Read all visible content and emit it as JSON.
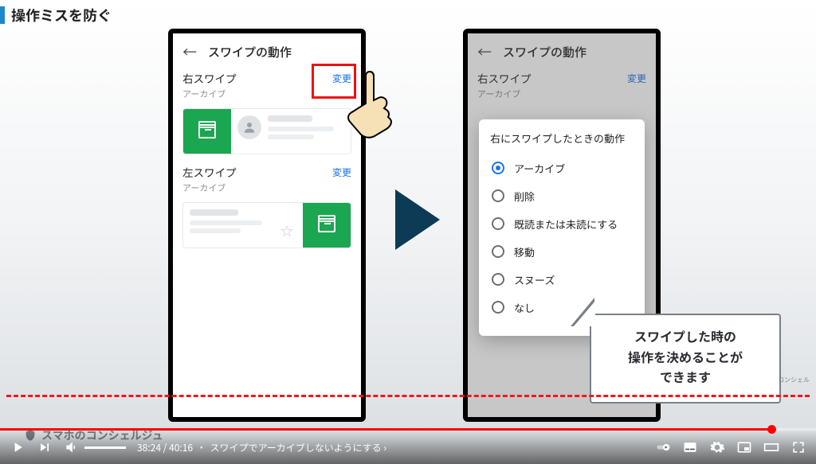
{
  "page_title": "操作ミスを防ぐ",
  "phone_header": "スワイプの動作",
  "right_section": {
    "title": "右スワイプ",
    "subtitle": "アーカイブ",
    "change": "変更"
  },
  "left_section": {
    "title": "左スワイプ",
    "subtitle": "アーカイブ",
    "change": "変更"
  },
  "dialog": {
    "title": "右にスワイプしたときの動作",
    "options": [
      "アーカイブ",
      "削除",
      "既読または未読にする",
      "移動",
      "スヌーズ",
      "なし"
    ],
    "selected": 0
  },
  "bubble": {
    "l1": "スワイプした時の",
    "l2": "操作を決めることが",
    "l3": "できます"
  },
  "brand_small": "コアコンシェル",
  "watermark": "スマホのコンシェルジュ",
  "player": {
    "current": "38:24",
    "total": "40:16",
    "sep": "・",
    "chapter": "スワイプでアーカイブしないようにする",
    "chev": "›"
  }
}
